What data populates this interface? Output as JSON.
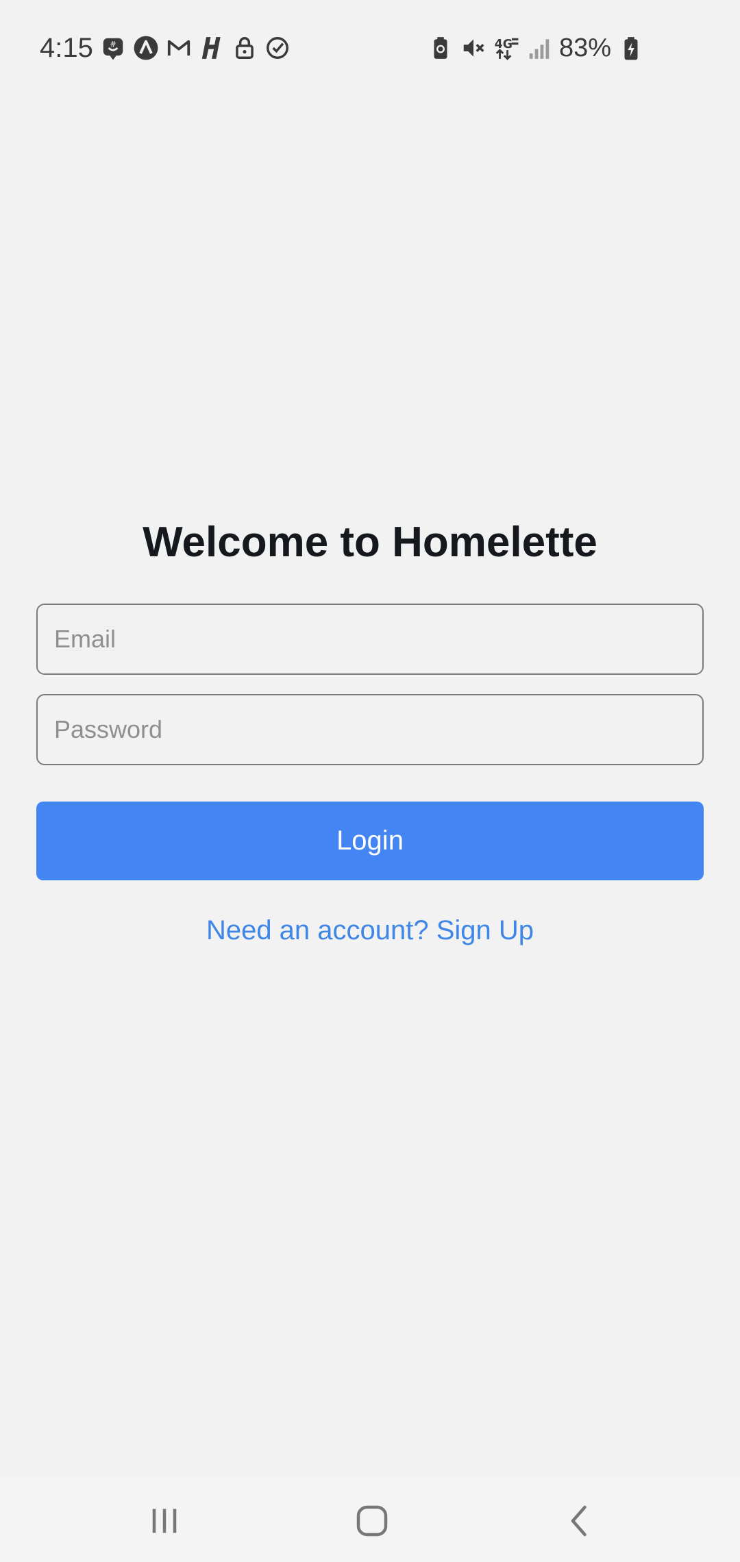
{
  "status_bar": {
    "time": "4:15",
    "battery_percent": "83%",
    "left_icons": [
      "groupme-icon",
      "nav-arrow-icon",
      "gmail-icon",
      "h-app-icon",
      "lock-icon",
      "check-circle-icon"
    ],
    "right_icons": [
      "battery-saver-icon",
      "mute-icon",
      "4g-lte-icon",
      "signal-icon",
      "battery-charging-icon"
    ],
    "network_label": "4G"
  },
  "login": {
    "title": "Welcome to Homelette",
    "email_placeholder": "Email",
    "email_value": "",
    "password_placeholder": "Password",
    "password_value": "",
    "login_label": "Login",
    "signup_link": "Need an account? Sign Up"
  },
  "nav_bar": {
    "icons": [
      "recents-icon",
      "home-icon",
      "back-icon"
    ]
  },
  "colors": {
    "background": "#f2f2f3",
    "primary": "#4385f3",
    "link": "#3f86e6",
    "title": "#15191d",
    "border": "#7c7c7c",
    "placeholder": "#8f8f8f"
  }
}
